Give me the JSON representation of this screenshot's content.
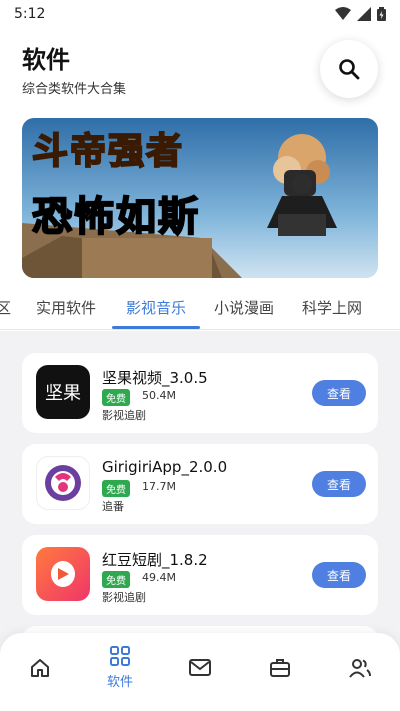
{
  "status_bar": {
    "time": "5:12"
  },
  "header": {
    "title": "软件",
    "subtitle": "综合类软件大合集"
  },
  "banner": {
    "line1": "斗帝强者",
    "line2": "恐怖如斯"
  },
  "tabs": [
    {
      "label": "区"
    },
    {
      "label": "实用软件"
    },
    {
      "label": "影视音乐",
      "active": true
    },
    {
      "label": "小说漫画"
    },
    {
      "label": "科学上网"
    }
  ],
  "apps": [
    {
      "name": "坚果视频_3.0.5",
      "badge": "免费",
      "size": "50.4M",
      "category": "影视追剧",
      "icon_text": "坚果",
      "button": "查看"
    },
    {
      "name": "GirigiriApp_2.0.0",
      "badge": "免费",
      "size": "17.7M",
      "category": "追番",
      "button": "查看"
    },
    {
      "name": "红豆短剧_1.8.2",
      "badge": "免费",
      "size": "49.4M",
      "category": "影视追剧",
      "button": "查看"
    }
  ],
  "bottom_nav": [
    {
      "icon": "home-icon"
    },
    {
      "icon": "grid-icon",
      "label": "软件",
      "active": true
    },
    {
      "icon": "mail-icon"
    },
    {
      "icon": "toolbox-icon"
    },
    {
      "icon": "users-icon"
    }
  ],
  "colors": {
    "accent": "#3e7ad8",
    "button": "#4f7fe0",
    "badge": "#2fa84f"
  }
}
